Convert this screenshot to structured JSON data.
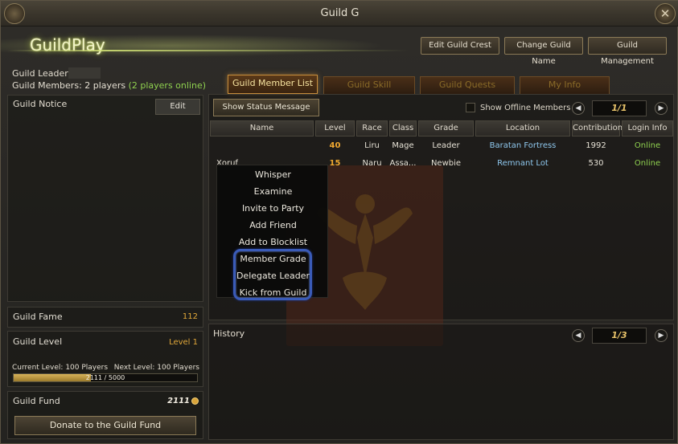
{
  "window": {
    "title": "Guild G"
  },
  "header": {
    "guild_name": "GuildPlay",
    "buttons": [
      "Edit Guild Crest",
      "Change Guild Name",
      "Guild Management"
    ]
  },
  "info": {
    "leader_label": "Guild Leader:",
    "members_label": "Guild Members: 2 players",
    "members_online": "(2 players online)"
  },
  "notice": {
    "title": "Guild Notice",
    "edit_label": "Edit"
  },
  "fame": {
    "label": "Guild Fame",
    "value": "112"
  },
  "level": {
    "label": "Guild Level",
    "value": "Level 1",
    "current": "Current Level: 100 Players",
    "next": "Next Level: 100 Players",
    "xp_text": "2111 / 5000",
    "xp_fraction": 0.42
  },
  "fund": {
    "label": "Guild Fund",
    "value": "2111",
    "donate_label": "Donate to the Guild Fund"
  },
  "tabs": [
    "Guild Member List",
    "Guild Skill",
    "Guild Quests",
    "My Info"
  ],
  "list": {
    "status_button": "Show Status Message",
    "offline_label": "Show Offline Members",
    "page": "1/1",
    "columns": [
      "Name",
      "Level",
      "Race",
      "Class",
      "Grade",
      "Location",
      "Contribution",
      "Login Info"
    ],
    "rows": [
      {
        "name": "",
        "level": "40",
        "race": "Liru",
        "class": "Mage",
        "grade": "Leader",
        "location": "Baratan Fortress",
        "contribution": "1992",
        "login": "Online"
      },
      {
        "name": "Xoruf",
        "level": "15",
        "race": "Naru",
        "class": "Assa...",
        "grade": "Newbie",
        "location": "Remnant Lot",
        "contribution": "530",
        "login": "Online"
      }
    ]
  },
  "context_menu": [
    "Whisper",
    "Examine",
    "Invite to Party",
    "Add Friend",
    "Add to Blocklist",
    "Member Grade",
    "Delegate Leader",
    "Kick from Guild"
  ],
  "history": {
    "title": "History",
    "page": "1/3"
  },
  "icons": {
    "close": "close-icon",
    "prev": "chevron-left-icon",
    "next": "chevron-right-icon",
    "coin": "coin-icon",
    "emblem": "eagle-emblem-icon"
  },
  "colors": {
    "accent_gold": "#e3a93a",
    "online": "#8fd14f",
    "location": "#8fc8ee",
    "highlight": "#3a5bb8"
  }
}
